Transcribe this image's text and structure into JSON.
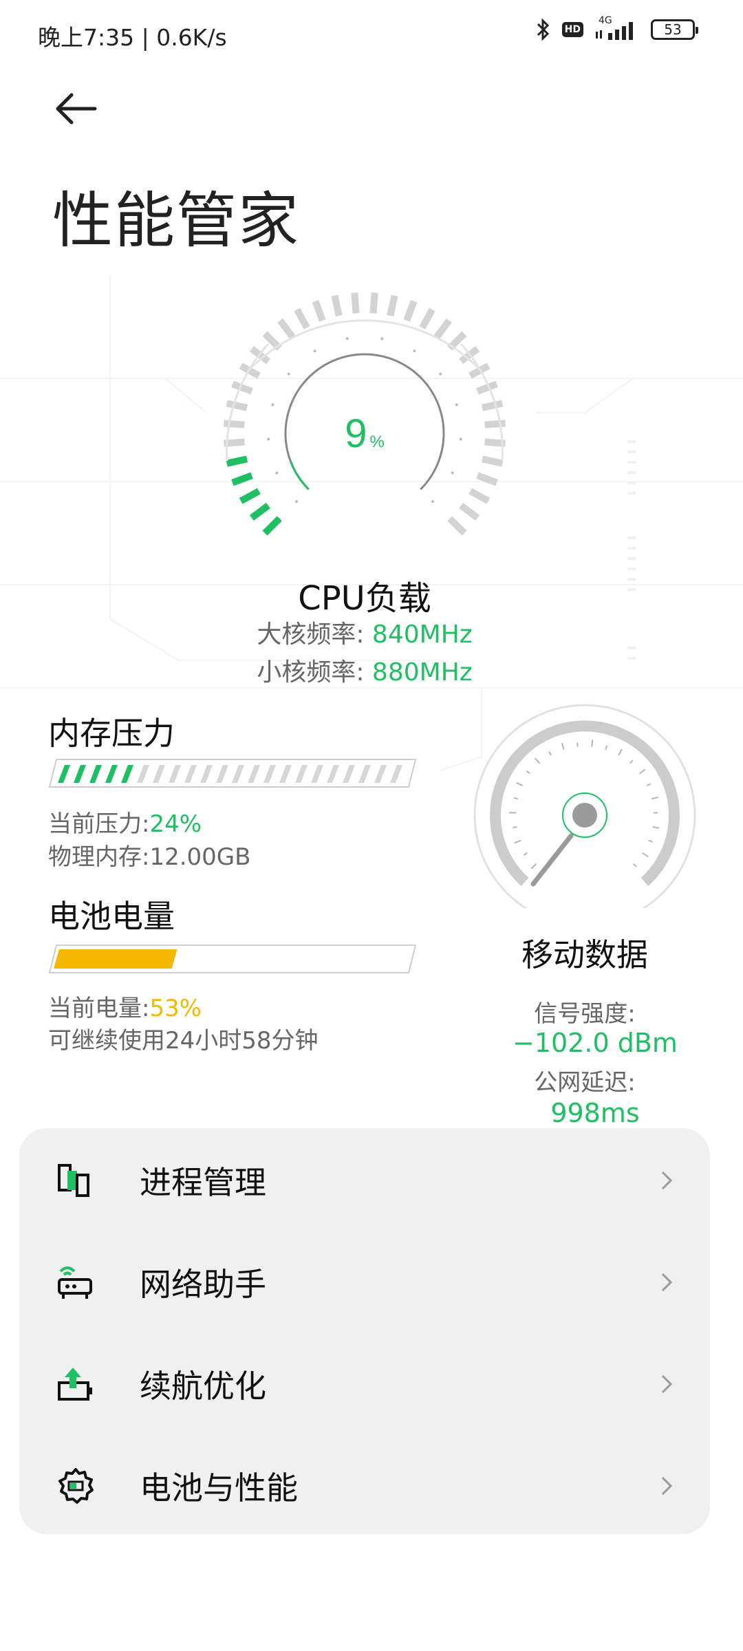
{
  "status_bar": {
    "time": "晚上7:35 | 0.6K/s",
    "icons": [
      "bluetooth-icon",
      "hd-icon",
      "signal-4g-icon"
    ],
    "hd_label": "HD",
    "network_label": "4G",
    "battery_level": "53"
  },
  "header": {
    "back_icon": "arrow-left-icon",
    "title": "性能管家"
  },
  "cpu": {
    "percent_value": "9",
    "percent_unit": "%",
    "load_fraction": 0.09,
    "label": "CPU负载",
    "big_core_label": "大核频率:",
    "big_core_value": "840MHz",
    "small_core_label": "小核频率:",
    "small_core_value": "880MHz"
  },
  "memory": {
    "title": "内存压力",
    "pressure_label": "当前压力:",
    "pressure_value": "24%",
    "pressure_fraction": 0.24,
    "physical_label": "物理内存:",
    "physical_value": "12.00GB"
  },
  "battery": {
    "title": "电池电量",
    "level_label": "当前电量:",
    "level_value": "53%",
    "level_fraction": 0.53,
    "remaining": "可继续使用24小时58分钟"
  },
  "mobile_data": {
    "title": "移动数据",
    "signal_label": "信号强度:",
    "signal_value": "−102.0 dBm",
    "latency_label": "公网延迟:",
    "latency_value": "998ms"
  },
  "menu": {
    "items": [
      {
        "label": "进程管理",
        "icon": "process-manager-icon"
      },
      {
        "label": "网络助手",
        "icon": "router-icon"
      },
      {
        "label": "续航优化",
        "icon": "battery-boost-icon"
      },
      {
        "label": "电池与性能",
        "icon": "gear-icon"
      }
    ],
    "chevron_icon": "chevron-right-icon"
  },
  "colors": {
    "accent_green": "#1fbf63",
    "battery_yellow": "#f5b800",
    "gauge_gray": "#cfcfcf"
  }
}
